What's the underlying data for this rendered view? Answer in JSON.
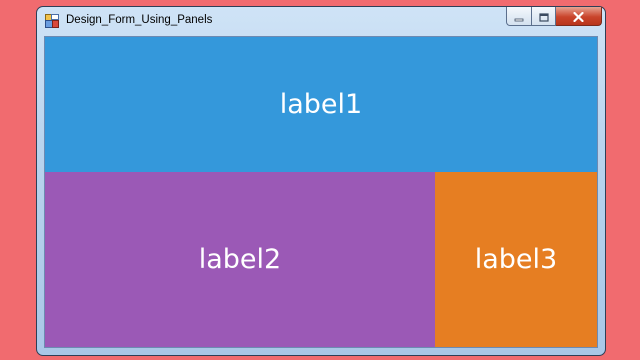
{
  "window": {
    "title": "Design_Form_Using_Panels",
    "background_color": "#f16b6f"
  },
  "titlebar": {
    "icon": "form-app-icon",
    "controls": [
      "minimize-icon",
      "maximize-icon",
      "close-icon"
    ]
  },
  "panels": [
    {
      "label": "label1",
      "color": "#3498db"
    },
    {
      "label": "label2",
      "color": "#9b59b6"
    },
    {
      "label": "label3",
      "color": "#e67e22"
    }
  ]
}
